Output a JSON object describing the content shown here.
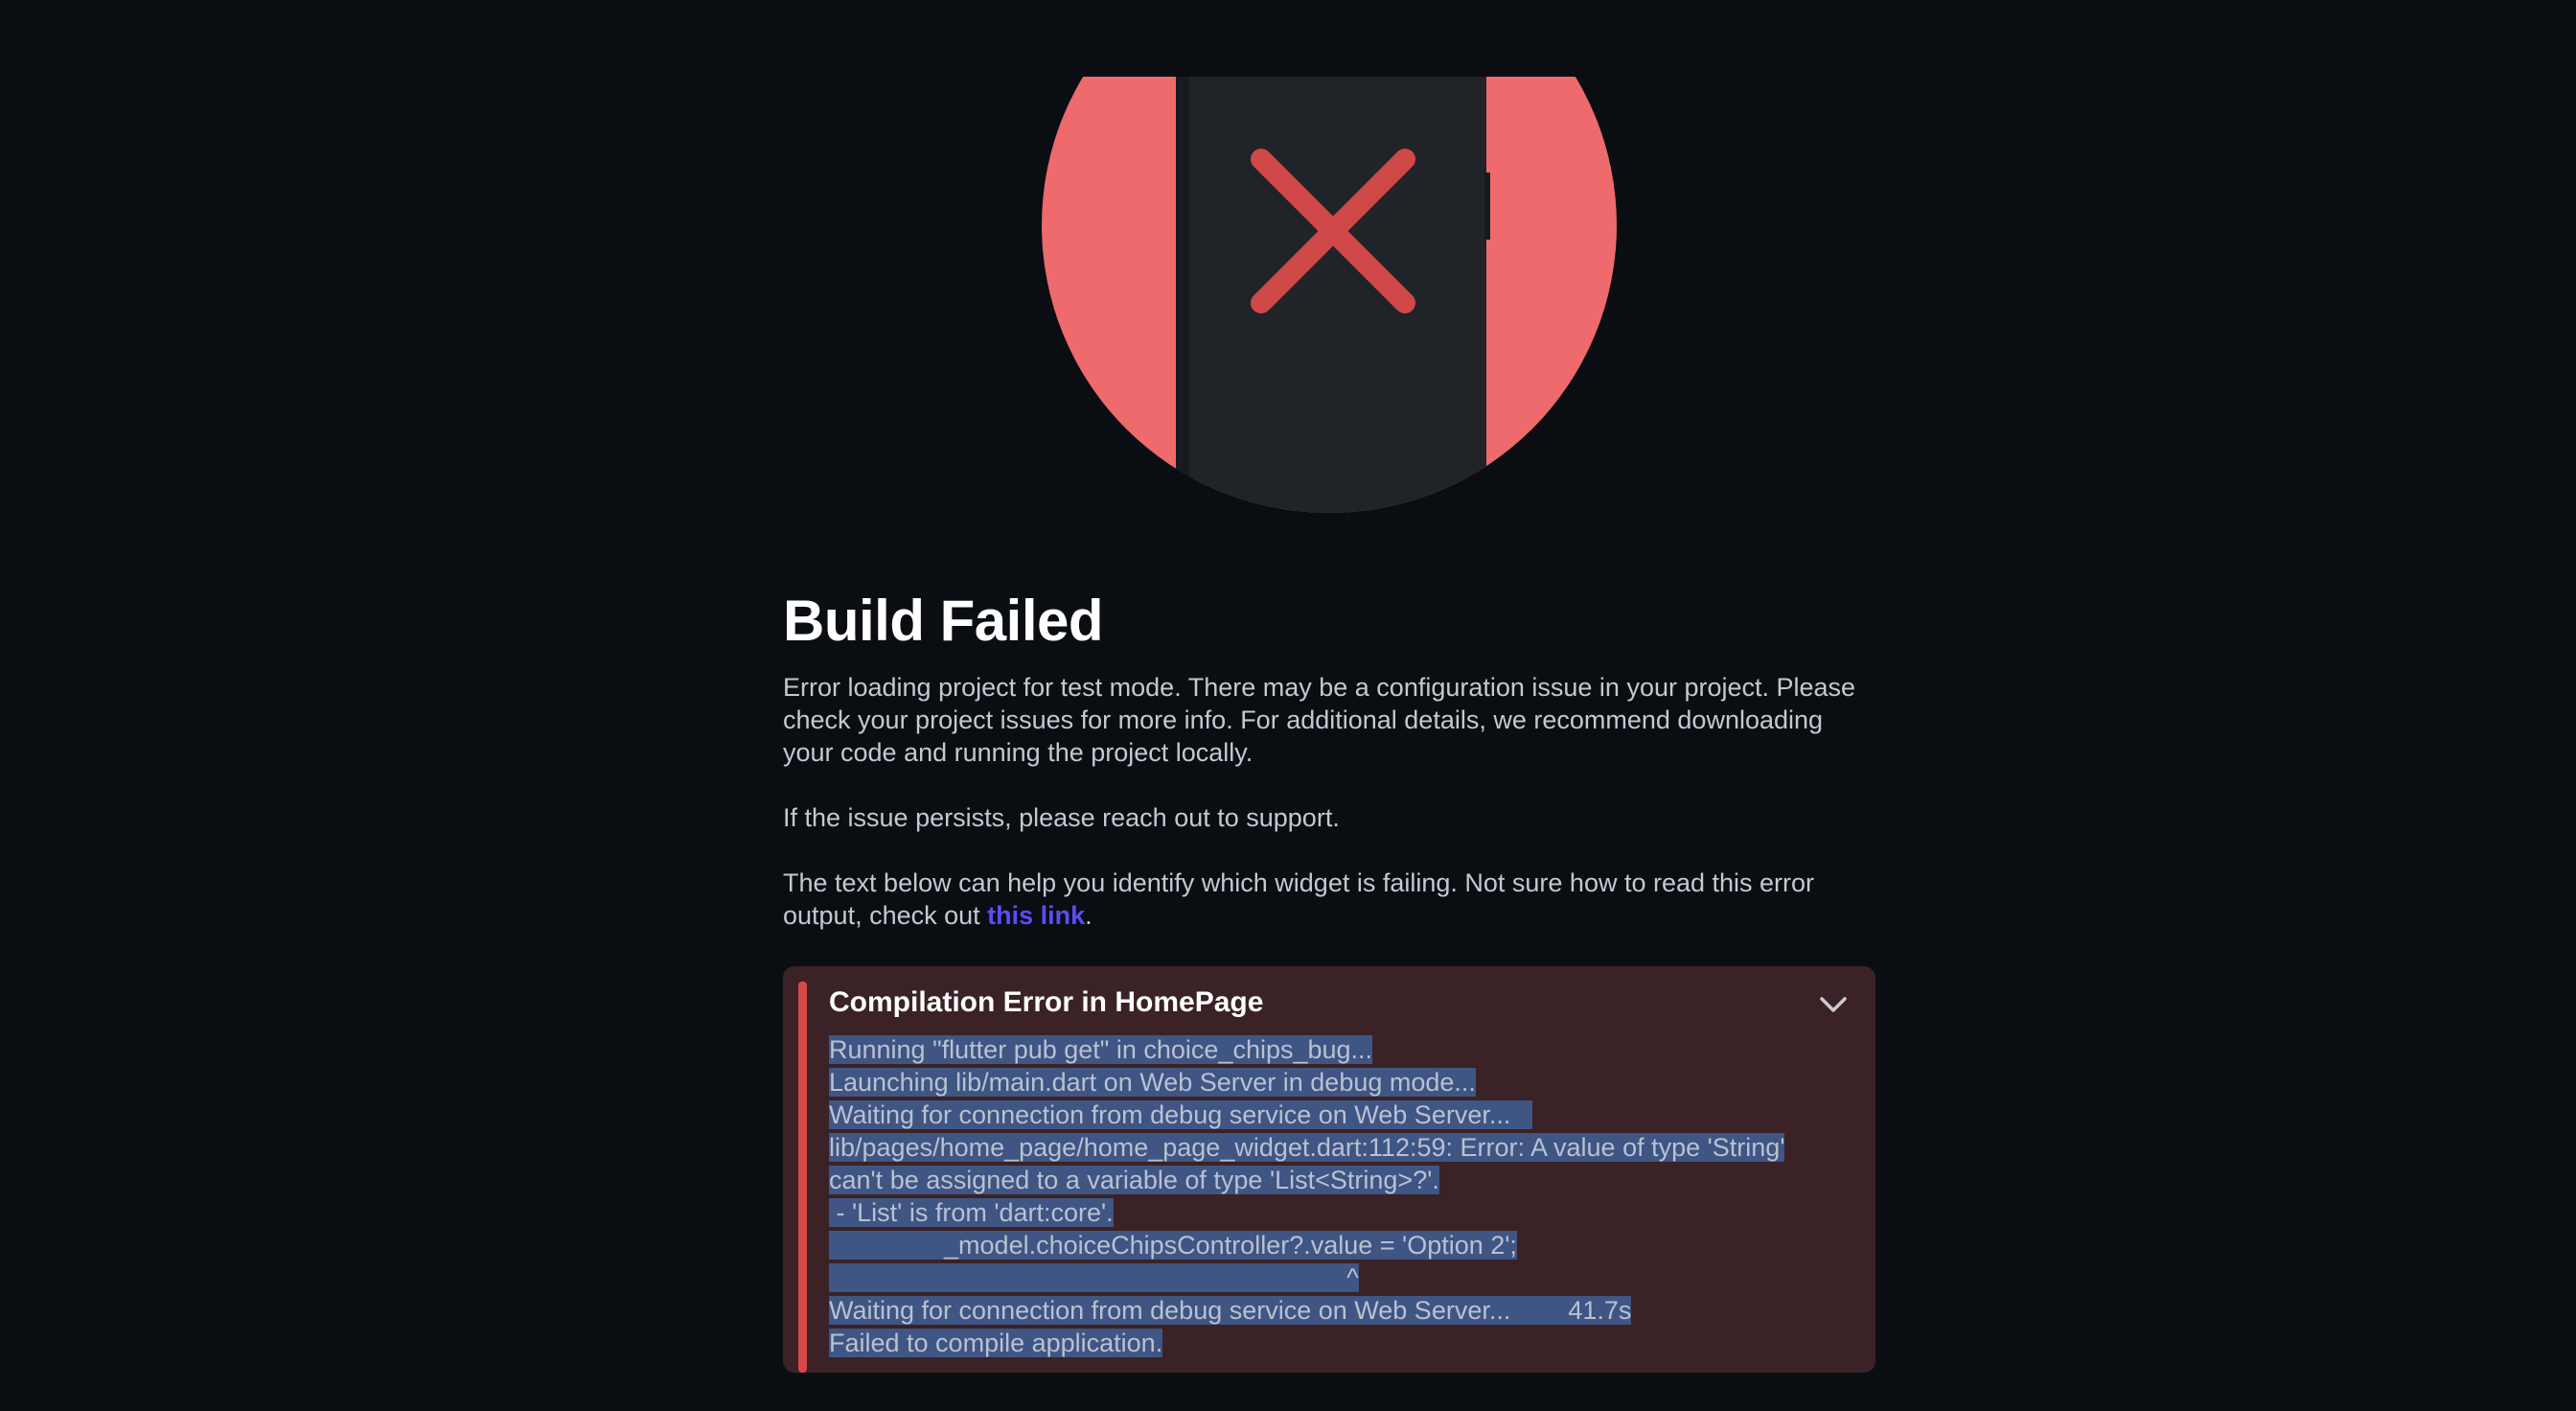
{
  "page": {
    "title": "Build Failed",
    "paragraphs": {
      "p1": "Error loading project for test mode. There may be a configuration issue in your project. Please check your project issues for more info. For additional details, we recommend downloading your code and running the project locally.",
      "p2": "If the issue persists, please reach out to support.",
      "p3_prefix": "The text below can help you identify which widget is failing. Not sure how to read this error output, check out ",
      "p3_link": "this link",
      "p3_suffix": "."
    }
  },
  "hero": {
    "icon": "build-failed-phone-x-icon",
    "colors": {
      "circle": "#ef6a6c",
      "phone": "#202328",
      "x": "#d04848"
    }
  },
  "error_panel": {
    "title": "Compilation Error in HomePage",
    "expand_icon": "chevron-down-icon",
    "accent_color": "#d94848",
    "log_lines": [
      "Running \"flutter pub get\" in choice_chips_bug...",
      "Launching lib/main.dart on Web Server in debug mode...",
      "Waiting for connection from debug service on Web Server...   ",
      "lib/pages/home_page/home_page_widget.dart:112:59: Error: A value of type 'String'",
      "can't be assigned to a variable of type 'List<String>?'.",
      " - 'List' is from 'dart:core'.",
      "                _model.choiceChipsController?.value = 'Option 2';",
      "                                                                        ^",
      "Waiting for connection from debug service on Web Server...        41.7s",
      "Failed to compile application."
    ]
  }
}
